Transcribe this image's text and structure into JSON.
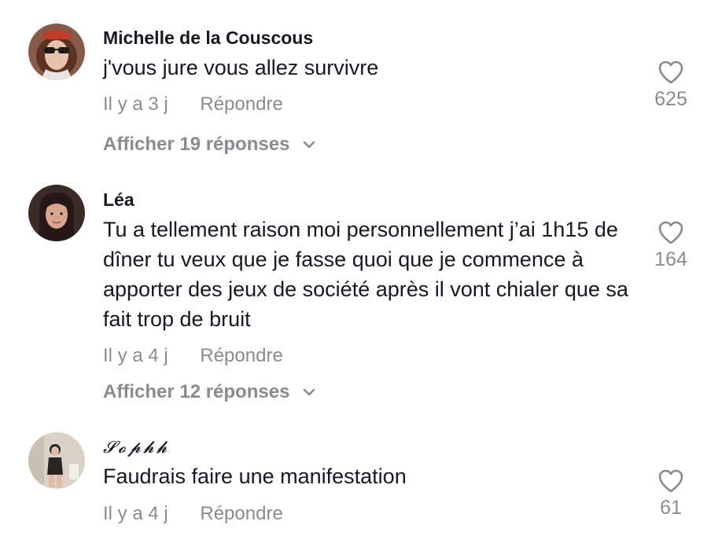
{
  "comments": [
    {
      "username": "Michelle de la Couscous",
      "text": "j'vous jure vous allez survivre",
      "age": "Il y a 3 j",
      "reply_label": "Répondre",
      "view_replies": "Afficher 19 réponses",
      "likes": "625",
      "avatar_colors": {
        "bg": "#8a5a48",
        "face": "#e8c3ab",
        "hair": "#5a3324",
        "accent": "#c23a2a"
      }
    },
    {
      "username": "Léa",
      "text": "Tu a tellement raison moi personnellement j’ai 1h15 de dîner tu veux que je fasse quoi que je commence à apporter des jeux de société après il vont chialer que sa fait trop de bruit",
      "age": "Il y a 4 j",
      "reply_label": "Répondre",
      "view_replies": "Afficher 12 réponses",
      "likes": "164",
      "avatar_colors": {
        "bg": "#3a2a28",
        "face": "#d9a58e",
        "hair": "#241818"
      }
    },
    {
      "username": "𝓢𝓸𝓹𝓱𝓱",
      "text": "Faudrais faire une manifestation",
      "age": "Il y a 4 j",
      "reply_label": "Répondre",
      "likes": "61",
      "avatar_colors": {
        "bg": "#d8d2c8",
        "figure": "#2a2422",
        "skin": "#e0bca8"
      }
    }
  ]
}
